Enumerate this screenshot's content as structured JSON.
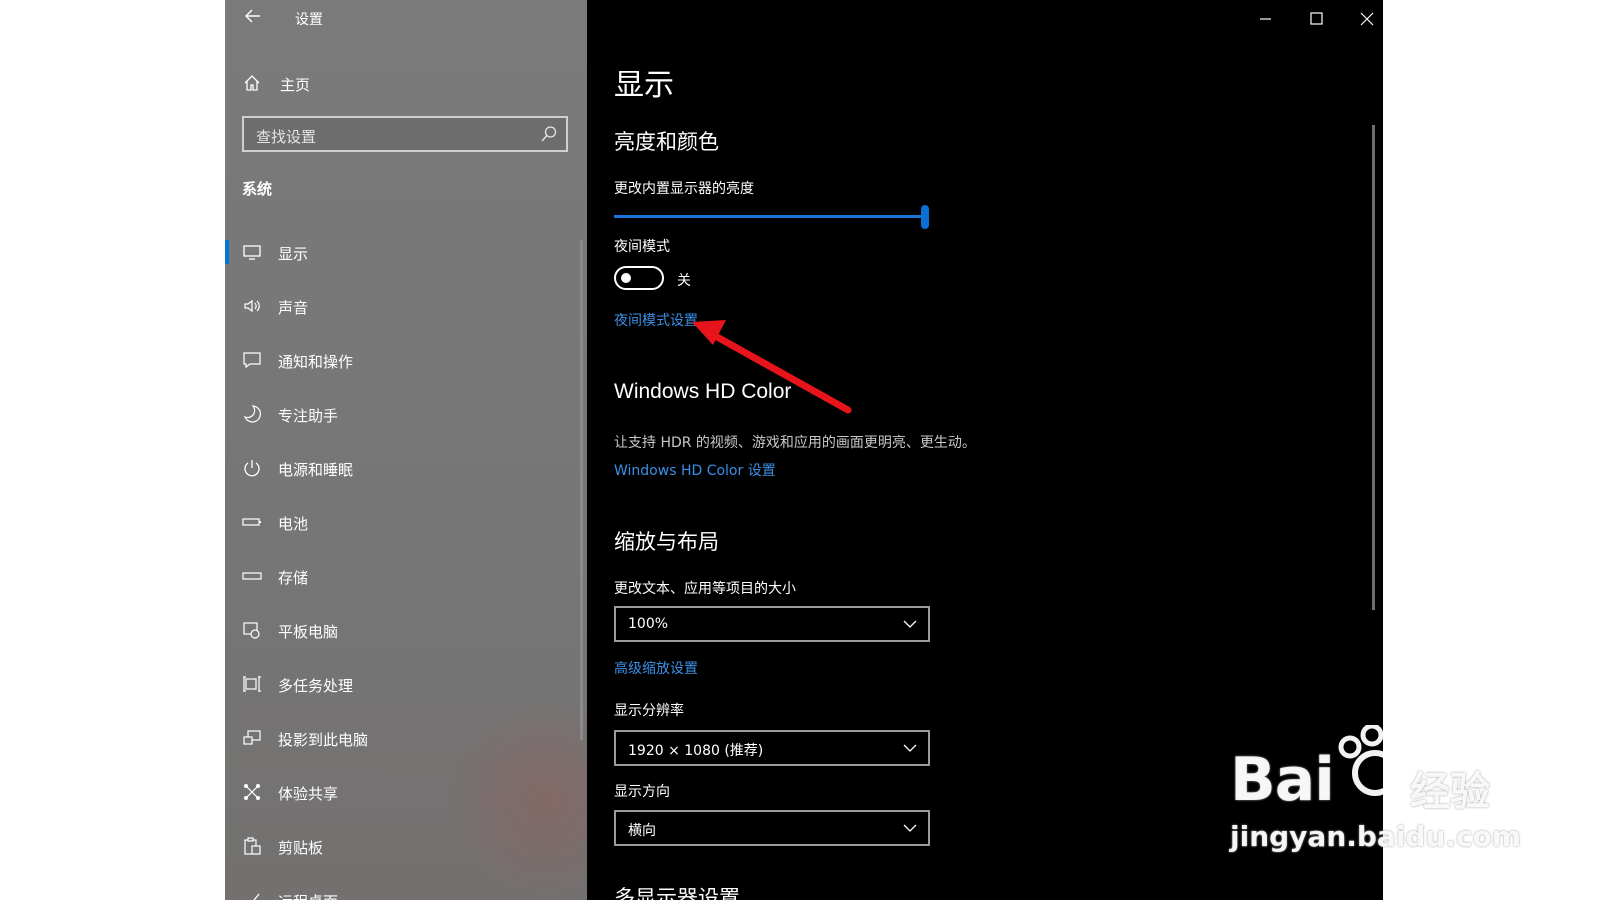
{
  "window": {
    "title": "设置",
    "back_icon": "arrow-left-icon",
    "minimize_icon": "minimize-icon",
    "maximize_icon": "maximize-icon",
    "close_icon": "close-icon"
  },
  "sidebar": {
    "home_label": "主页",
    "search_placeholder": "查找设置",
    "section_label": "系统",
    "items": [
      {
        "label": "显示",
        "icon": "monitor-icon",
        "active": true
      },
      {
        "label": "声音",
        "icon": "speaker-icon"
      },
      {
        "label": "通知和操作",
        "icon": "notification-icon"
      },
      {
        "label": "专注助手",
        "icon": "moon-icon"
      },
      {
        "label": "电源和睡眠",
        "icon": "power-icon"
      },
      {
        "label": "电池",
        "icon": "battery-icon"
      },
      {
        "label": "存储",
        "icon": "storage-icon"
      },
      {
        "label": "平板电脑",
        "icon": "tablet-icon"
      },
      {
        "label": "多任务处理",
        "icon": "multitasking-icon"
      },
      {
        "label": "投影到此电脑",
        "icon": "project-icon"
      },
      {
        "label": "体验共享",
        "icon": "shared-experiences-icon"
      },
      {
        "label": "剪贴板",
        "icon": "clipboard-icon"
      },
      {
        "label": "远程桌面",
        "icon": "remote-desktop-icon"
      }
    ]
  },
  "main": {
    "page_title": "显示",
    "brightness_section": "亮度和颜色",
    "brightness_label": "更改内置显示器的亮度",
    "brightness_value": 1.0,
    "night_mode_label": "夜间模式",
    "night_mode_state": "关",
    "night_mode_on": false,
    "night_mode_link": "夜间模式设置",
    "hd_title": "Windows HD Color",
    "hd_desc": "让支持 HDR 的视频、游戏和应用的画面更明亮、更生动。",
    "hd_link": "Windows HD Color 设置",
    "scale_section": "缩放与布局",
    "scale_label": "更改文本、应用等项目的大小",
    "scale_value": "100%",
    "advanced_scale_link": "高级缩放设置",
    "resolution_label": "显示分辨率",
    "resolution_value": "1920 × 1080 (推荐)",
    "orientation_label": "显示方向",
    "orientation_value": "横向",
    "multi_display_section": "多显示器设置"
  },
  "annotation": {
    "arrow_color": "#e8141b"
  },
  "watermark": {
    "brand": "Bai",
    "brand2": "经验",
    "domain": "jingyan.baidu.com"
  },
  "colors": {
    "accent": "#0078d7",
    "link": "#3b8fe6",
    "sidebar": "#777777",
    "main_bg": "#000000"
  }
}
